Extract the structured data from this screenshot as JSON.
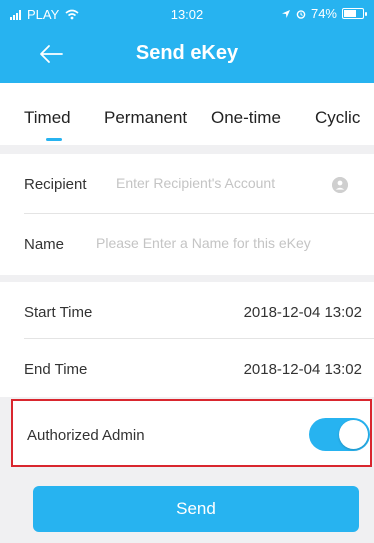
{
  "colors": {
    "accent": "#27b3f0",
    "highlight_border": "#d9262e",
    "background": "#f0f0f2"
  },
  "status_bar": {
    "carrier": "PLAY",
    "time": "13:02",
    "battery": "74%",
    "battery_level": 0.74,
    "icons": [
      "signal-icon",
      "wifi-icon",
      "location-icon",
      "alarm-icon",
      "battery-icon"
    ]
  },
  "header": {
    "title": "Send eKey",
    "back_icon": "back-arrow-icon"
  },
  "tabs": {
    "items": [
      {
        "label": "Timed",
        "active": true
      },
      {
        "label": "Permanent",
        "active": false
      },
      {
        "label": "One-time",
        "active": false
      },
      {
        "label": "Cyclic",
        "active": false
      }
    ]
  },
  "form": {
    "recipient": {
      "label": "Recipient",
      "placeholder": "Enter Recipient's Account",
      "value": "",
      "icon": "person-icon"
    },
    "name": {
      "label": "Name",
      "placeholder": "Please Enter a Name for this eKey",
      "value": ""
    },
    "start_time": {
      "label": "Start Time",
      "value": "2018-12-04 13:02"
    },
    "end_time": {
      "label": "End Time",
      "value": "2018-12-04 13:02"
    },
    "authorized_admin": {
      "label": "Authorized Admin",
      "enabled": true
    }
  },
  "send_button": {
    "label": "Send"
  }
}
